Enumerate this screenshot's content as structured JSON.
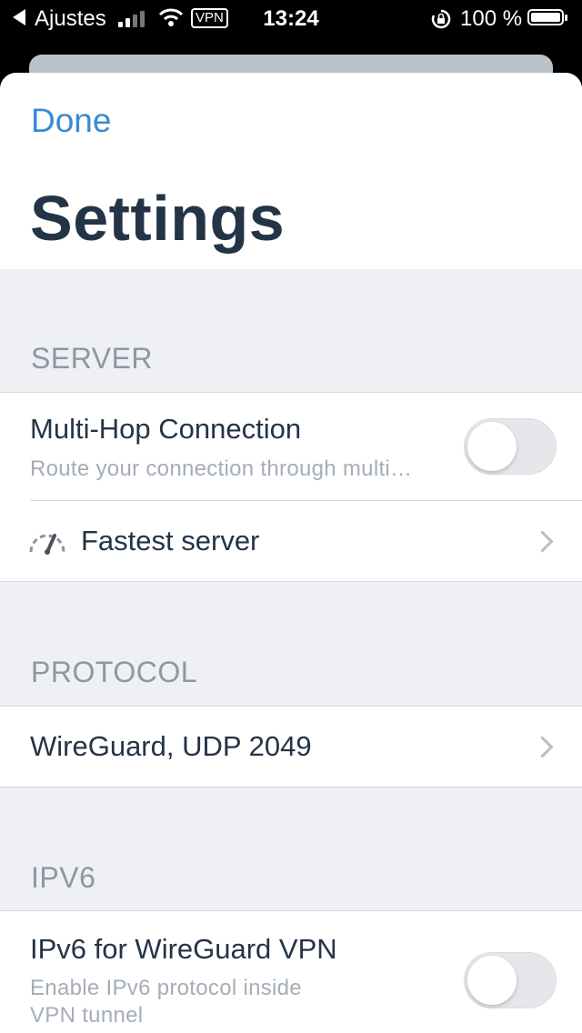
{
  "status_bar": {
    "back_app": "Ajustes",
    "vpn_badge": "VPN",
    "time": "13:24",
    "battery": "100 %"
  },
  "header": {
    "done_label": "Done",
    "title": "Settings"
  },
  "sections": {
    "server": {
      "label": "SERVER",
      "multihop_title": "Multi-Hop Connection",
      "multihop_subtitle": "Route your connection through multi…",
      "multihop_enabled": false,
      "fastest_label": "Fastest server"
    },
    "protocol": {
      "label": "PROTOCOL",
      "value": "WireGuard, UDP 2049"
    },
    "ipv6": {
      "label": "IPV6",
      "title": "IPv6 for WireGuard VPN",
      "subtitle_line1": "Enable IPv6 protocol inside",
      "subtitle_line2": "VPN tunnel",
      "enabled": false
    }
  },
  "colors": {
    "accent": "#3a8ad2",
    "title": "#243447",
    "section_label": "#8d97a4",
    "background": "#eff0f3"
  }
}
